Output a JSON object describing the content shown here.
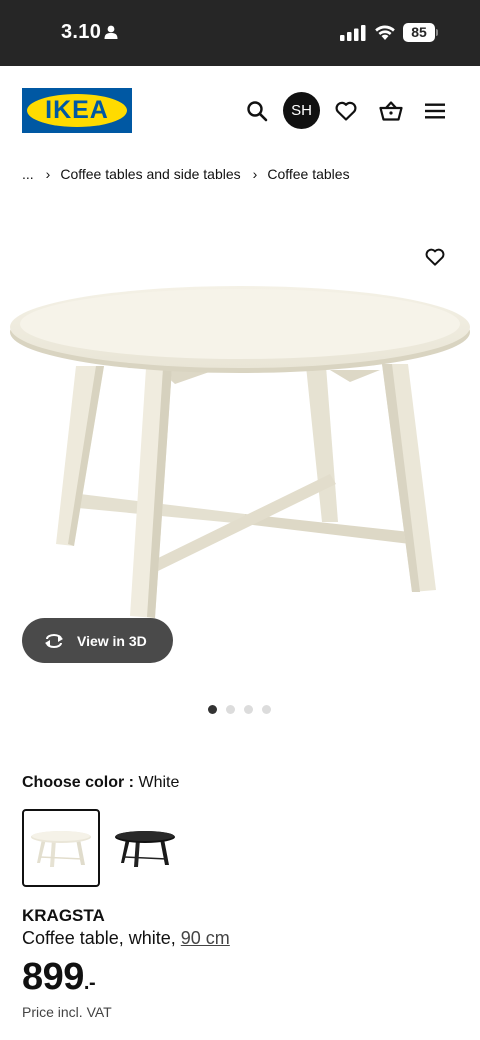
{
  "status_bar": {
    "time": "3.10",
    "battery": "85"
  },
  "header": {
    "logo_text": "IKEA",
    "avatar_initials": "SH"
  },
  "breadcrumb": {
    "ellipsis": "...",
    "items": [
      "Coffee tables and side tables",
      "Coffee tables"
    ]
  },
  "gallery": {
    "view3d_label": "View in 3D",
    "image_count": 4,
    "active_index": 0
  },
  "color": {
    "label": "Choose color :",
    "selected": "White",
    "options": [
      "White",
      "Black"
    ]
  },
  "product": {
    "name": "KRAGSTA",
    "description": "Coffee table, white,",
    "size": "90 cm",
    "price": "899",
    "price_suffix": ".-",
    "vat_note": "Price incl. VAT"
  },
  "colors": {
    "ikea_blue": "#0058a3",
    "ikea_yellow": "#ffdb00",
    "status_bar": "#262626"
  }
}
